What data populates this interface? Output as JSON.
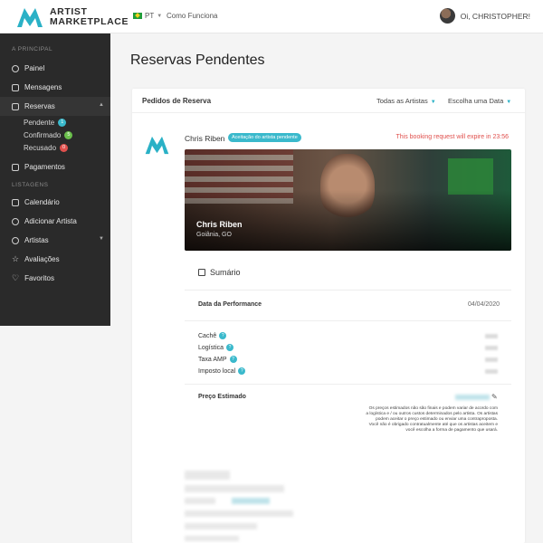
{
  "header": {
    "brand_line1": "ARTIST",
    "brand_line2": "MARKETPLACE",
    "language": "PT",
    "how_it_works": "Como Funciona",
    "greeting": "Oi, CHRISTOPHER!"
  },
  "sidebar": {
    "section_main": "A PRINCIPAL",
    "panel": "Painel",
    "messages": "Mensagens",
    "bookings": "Reservas",
    "pending": "Pendente",
    "pending_count": "1",
    "confirmed": "Confirmado",
    "confirmed_count": "5",
    "refused": "Recusado",
    "refused_count": "0",
    "payments": "Pagamentos",
    "section_listings": "LISTAGENS",
    "calendar": "Calendário",
    "add_artist": "Adicionar Artista",
    "artists": "Artistas",
    "reviews": "Avaliações",
    "favorites": "Favoritos"
  },
  "main": {
    "title": "Reservas Pendentes",
    "card_title": "Pedidos de Reserva",
    "filter_artists": "Todas as Artistas",
    "filter_date": "Escolha uma Data"
  },
  "booking": {
    "artist": "Chris Riben",
    "status_tag": "Aceitação do artista pendente",
    "expire": "This booking request will expire in 23:56",
    "hero_name": "Chris Riben",
    "hero_city": "Goiânia, GO",
    "summary": "Sumário",
    "performance_date_label": "Data da Performance",
    "performance_date": "04/04/2020",
    "cache": "Cachê",
    "logistics": "Logística",
    "amp_fee": "Taxa AMP",
    "local_tax": "Imposto local",
    "estimated_price": "Preço Estimado",
    "note": "Os preços estimados não são finais e podem variar de acordo com a logística e / ou outros custos determinados pelo artista. Os artistas podem aceitar o preço estimado ou enviar uma contraproposta. Você não é obrigado contratualmente até que os artistas aceitem e você escolha a forma de pagamento que usará."
  },
  "colors": {
    "accent": "#2ab1c6",
    "sidebar": "#2a2a2a",
    "alert": "#e0504d"
  }
}
